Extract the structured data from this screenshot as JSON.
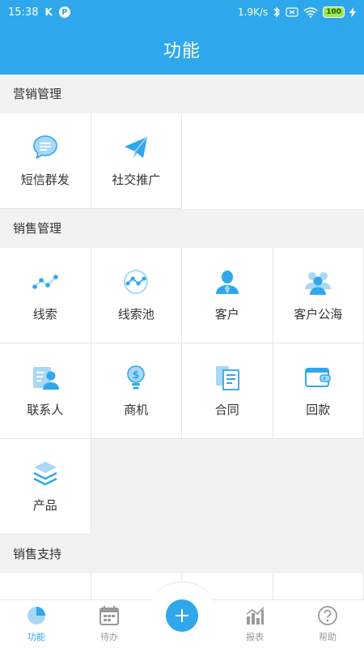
{
  "status": {
    "time": "15:38",
    "k_badge": "K",
    "p_badge": "P",
    "speed": "1.9K/s",
    "battery": "100"
  },
  "header": {
    "title": "功能"
  },
  "sections": [
    {
      "title": "营销管理",
      "items": [
        {
          "label": "短信群发",
          "icon": "sms-bubble-icon"
        },
        {
          "label": "社交推广",
          "icon": "paper-plane-icon"
        }
      ]
    },
    {
      "title": "销售管理",
      "items": [
        {
          "label": "线索",
          "icon": "lead-line-icon"
        },
        {
          "label": "线索池",
          "icon": "lead-pool-icon"
        },
        {
          "label": "客户",
          "icon": "customer-icon"
        },
        {
          "label": "客户公海",
          "icon": "customer-pool-icon"
        },
        {
          "label": "联系人",
          "icon": "contact-card-icon"
        },
        {
          "label": "商机",
          "icon": "opportunity-bulb-icon"
        },
        {
          "label": "合同",
          "icon": "contract-icon"
        },
        {
          "label": "回款",
          "icon": "wallet-icon"
        },
        {
          "label": "产品",
          "icon": "product-layers-icon"
        }
      ]
    },
    {
      "title": "销售支持"
    }
  ],
  "tabbar": [
    {
      "label": "功能",
      "icon": "pie-chart-icon",
      "active": true
    },
    {
      "label": "待办",
      "icon": "calendar-icon",
      "active": false
    },
    {
      "label": "报表",
      "icon": "bar-chart-icon",
      "active": false
    },
    {
      "label": "帮助",
      "icon": "help-icon",
      "active": false
    }
  ],
  "fab": {
    "icon": "plus-icon"
  },
  "colors": {
    "primary": "#2fa7ec",
    "icon_light": "#a9d8f7",
    "background": "#f2f2f2"
  }
}
